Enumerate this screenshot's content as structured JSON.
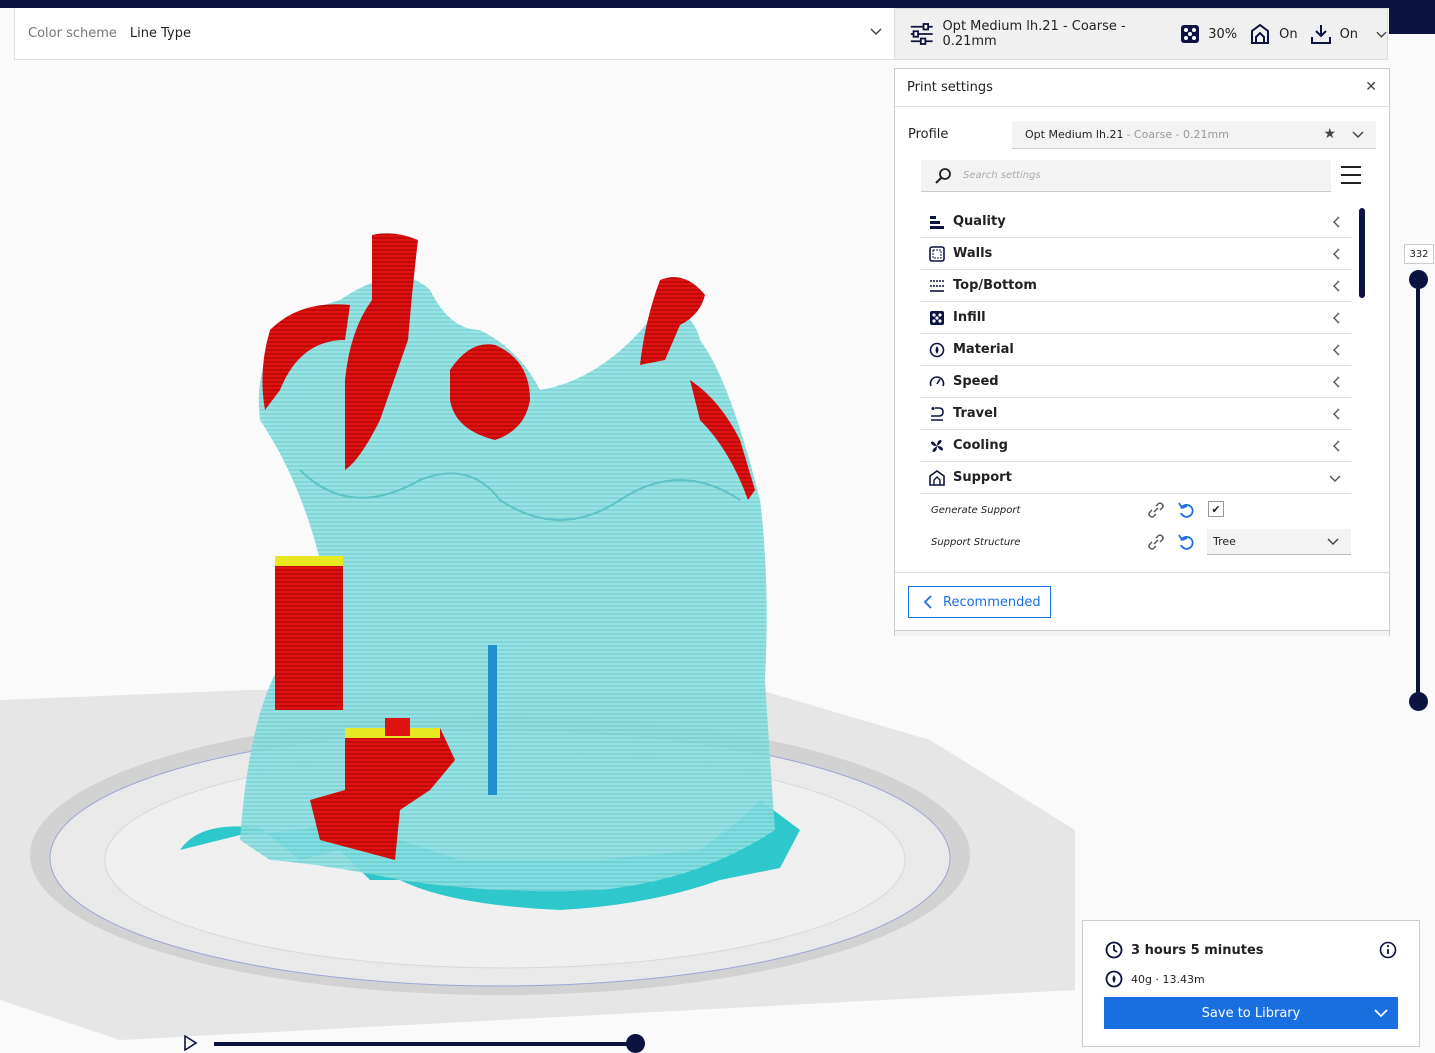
{
  "header": {
    "color_scheme_label": "Color scheme",
    "color_scheme_value": "Line Type",
    "profile_summary": "Opt Medium lh.21 - Coarse - 0.21mm",
    "infill": "30%",
    "support": "On",
    "adhesion": "On"
  },
  "print_settings": {
    "title": "Print settings",
    "profile_label": "Profile",
    "profile_name": "Opt Medium lh.21",
    "profile_detail": "- Coarse - 0.21mm",
    "search_placeholder": "Search settings",
    "categories": [
      {
        "label": "Quality",
        "icon": "quality-icon"
      },
      {
        "label": "Walls",
        "icon": "walls-icon"
      },
      {
        "label": "Top/Bottom",
        "icon": "top-bottom-icon"
      },
      {
        "label": "Infill",
        "icon": "infill-icon"
      },
      {
        "label": "Material",
        "icon": "material-icon"
      },
      {
        "label": "Speed",
        "icon": "speed-icon"
      },
      {
        "label": "Travel",
        "icon": "travel-icon"
      },
      {
        "label": "Cooling",
        "icon": "cooling-icon"
      },
      {
        "label": "Support",
        "icon": "support-icon"
      }
    ],
    "support_settings": {
      "generate_support_label": "Generate Support",
      "generate_support_checked": true,
      "support_structure_label": "Support Structure",
      "support_structure_value": "Tree"
    },
    "recommended_label": "Recommended"
  },
  "layer_slider": {
    "current_layer": "332"
  },
  "print_info": {
    "time": "3 hours 5 minutes",
    "material": "40g · 13.43m",
    "save_label": "Save to Library"
  },
  "colors": {
    "accent": "#1a6fe0",
    "dark": "#0c1340",
    "support": "#7fd8da",
    "wall_red": "#e01010",
    "skirt": "#2ec8cc"
  }
}
